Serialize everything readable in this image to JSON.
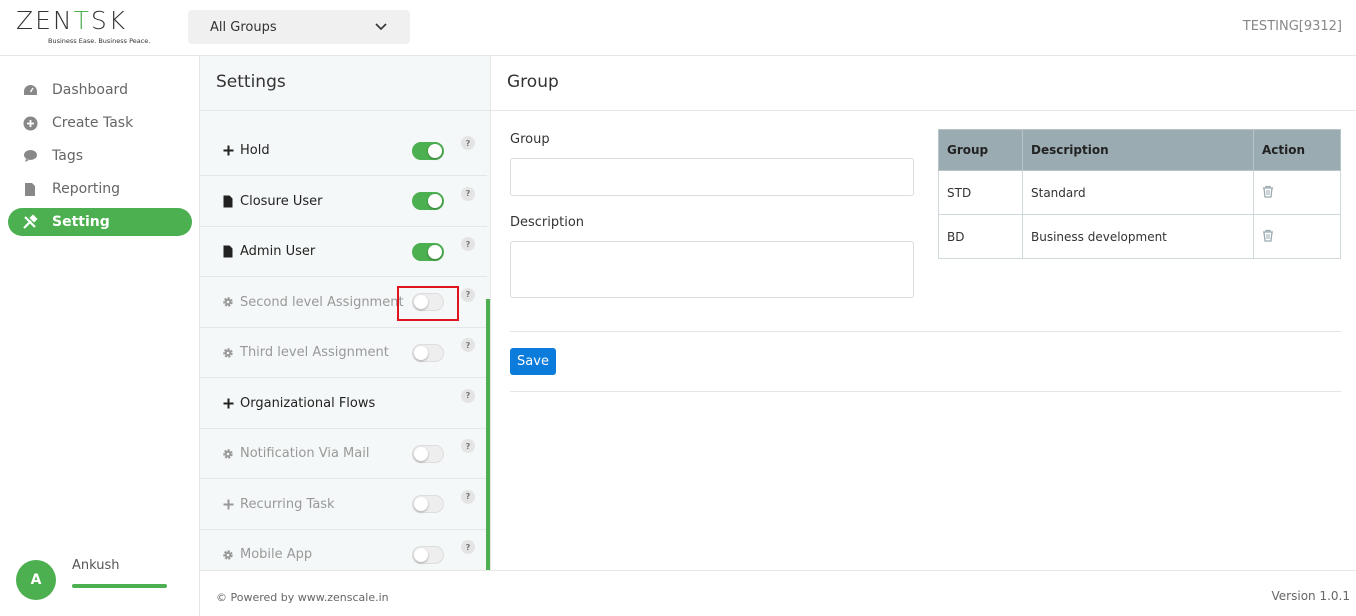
{
  "header": {
    "logo_main": "ZEN",
    "logo_accent": "T",
    "logo_end": "SK",
    "logo_tagline": "Business Ease. Business Peace.",
    "group_select_value": "All Groups",
    "account": "TESTING[9312]"
  },
  "nav": {
    "items": [
      {
        "label": "Dashboard",
        "icon": "dashboard-icon"
      },
      {
        "label": "Create Task",
        "icon": "plus-circle-icon"
      },
      {
        "label": "Tags",
        "icon": "tag-icon"
      },
      {
        "label": "Reporting",
        "icon": "file-icon"
      },
      {
        "label": "Setting",
        "icon": "tools-icon",
        "active": true
      }
    ],
    "user": {
      "initial": "A",
      "name": "Ankush"
    }
  },
  "settings": {
    "title": "Settings",
    "items": [
      {
        "label": "Hold",
        "icon": "plus-icon",
        "enabled": true,
        "toggle": true
      },
      {
        "label": "Closure User",
        "icon": "file-icon",
        "enabled": true,
        "toggle": true
      },
      {
        "label": "Admin User",
        "icon": "file-icon",
        "enabled": true,
        "toggle": true
      },
      {
        "label": "Second level Assignment",
        "icon": "gear-icon",
        "enabled": false,
        "toggle": true
      },
      {
        "label": "Third level Assignment",
        "icon": "gear-icon",
        "enabled": false,
        "toggle": true
      },
      {
        "label": "Organizational Flows",
        "icon": "plus-icon",
        "enabled": true,
        "toggle": false
      },
      {
        "label": "Notification Via Mail",
        "icon": "gear-icon",
        "enabled": false,
        "toggle": true
      },
      {
        "label": "Recurring Task",
        "icon": "plus-icon",
        "enabled": false,
        "toggle": true
      },
      {
        "label": "Mobile App",
        "icon": "gear-icon",
        "enabled": false,
        "toggle": true
      }
    ],
    "help_label": "?"
  },
  "main": {
    "title": "Group",
    "group_label": "Group",
    "group_value": "",
    "description_label": "Description",
    "description_value": "",
    "save_label": "Save",
    "table": {
      "headers": [
        "Group",
        "Description",
        "Action"
      ],
      "rows": [
        {
          "group": "STD",
          "description": "Standard"
        },
        {
          "group": "BD",
          "description": "Business development"
        }
      ]
    }
  },
  "footer": {
    "powered": "© Powered by www.zenscale.in",
    "version": "Version 1.0.1"
  },
  "colors": {
    "accent": "#4caf50",
    "primary_button": "#0b7bdc",
    "highlight": "#e0141e",
    "table_header": "#9aabb1"
  }
}
